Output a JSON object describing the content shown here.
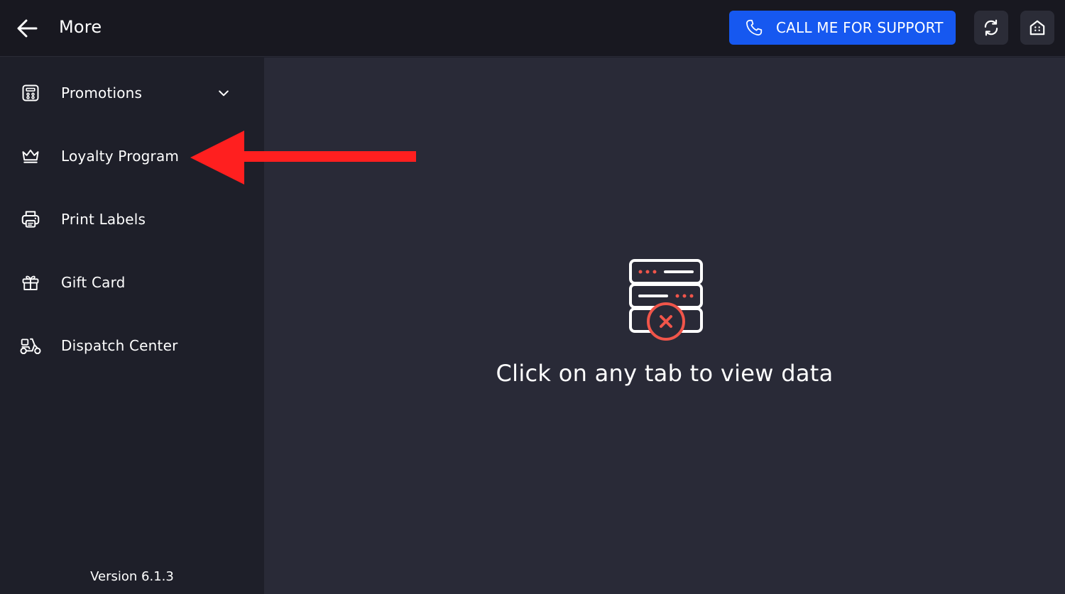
{
  "header": {
    "title": "More",
    "support_button_label": "CALL ME FOR SUPPORT"
  },
  "sidebar": {
    "items": [
      {
        "label": "Promotions",
        "icon": "promotions-icon",
        "has_chevron": true
      },
      {
        "label": "Loyalty Program",
        "icon": "crown-icon"
      },
      {
        "label": "Print Labels",
        "icon": "printer-icon"
      },
      {
        "label": "Gift Card",
        "icon": "gift-icon"
      },
      {
        "label": "Dispatch Center",
        "icon": "scooter-icon"
      }
    ],
    "version": "Version 6.1.3"
  },
  "main": {
    "empty_state_text": "Click on any tab to view data",
    "empty_state_icon": "server-error-icon"
  },
  "colors": {
    "header_bg": "#181820",
    "sidebar_bg": "#1e1f29",
    "main_bg": "#292a37",
    "primary_button": "#1658f0",
    "icon_button_bg": "#2b2c37",
    "accent_red": "#f0554a",
    "annotation_arrow": "#ff1f1f"
  }
}
